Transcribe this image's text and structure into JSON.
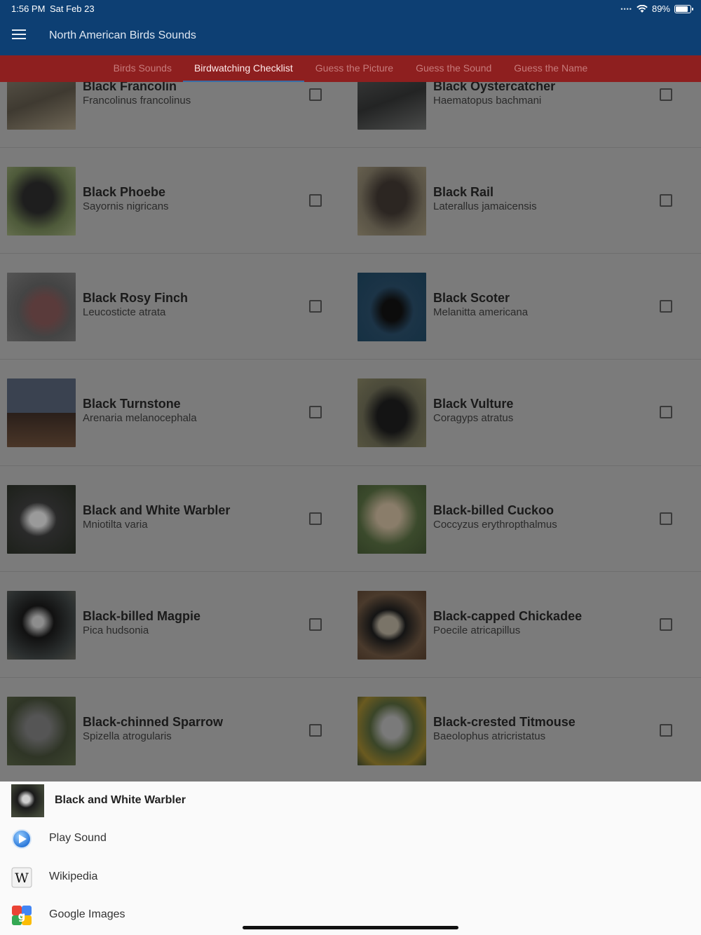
{
  "status": {
    "time": "1:56 PM",
    "date": "Sat Feb 23",
    "battery": "89%",
    "battery_level": 0.89
  },
  "app": {
    "title": "North American Birds Sounds"
  },
  "tabs": [
    {
      "label": "Birds Sounds",
      "active": false
    },
    {
      "label": "Birdwatching Checklist",
      "active": true
    },
    {
      "label": "Guess the Picture",
      "active": false
    },
    {
      "label": "Guess the Sound",
      "active": false
    },
    {
      "label": "Guess the Name",
      "active": false
    }
  ],
  "birds": [
    {
      "name": "Black Francolin",
      "scientific": "Francolinus francolinus",
      "checked": false
    },
    {
      "name": "Black Oystercatcher",
      "scientific": "Haematopus bachmani",
      "checked": false
    },
    {
      "name": "Black Phoebe",
      "scientific": "Sayornis nigricans",
      "checked": false
    },
    {
      "name": "Black Rail",
      "scientific": "Laterallus jamaicensis",
      "checked": false
    },
    {
      "name": "Black Rosy Finch",
      "scientific": "Leucosticte atrata",
      "checked": false
    },
    {
      "name": "Black Scoter",
      "scientific": "Melanitta americana",
      "checked": false
    },
    {
      "name": "Black Turnstone",
      "scientific": "Arenaria melanocephala",
      "checked": false
    },
    {
      "name": "Black Vulture",
      "scientific": "Coragyps atratus",
      "checked": false
    },
    {
      "name": "Black and White Warbler",
      "scientific": "Mniotilta varia",
      "checked": false
    },
    {
      "name": "Black-billed Cuckoo",
      "scientific": "Coccyzus erythropthalmus",
      "checked": false
    },
    {
      "name": "Black-billed Magpie",
      "scientific": "Pica hudsonia",
      "checked": false
    },
    {
      "name": "Black-capped Chickadee",
      "scientific": "Poecile atricapillus",
      "checked": false
    },
    {
      "name": "Black-chinned Sparrow",
      "scientific": "Spizella atrogularis",
      "checked": false
    },
    {
      "name": "Black-crested Titmouse",
      "scientific": "Baeolophus atricristatus",
      "checked": false
    }
  ],
  "sheet": {
    "title": "Black and White Warbler",
    "items": [
      {
        "label": "Play Sound",
        "icon": "play-sound-icon"
      },
      {
        "label": "Wikipedia",
        "icon": "wikipedia-icon"
      },
      {
        "label": "Google Images",
        "icon": "google-images-icon"
      }
    ]
  }
}
